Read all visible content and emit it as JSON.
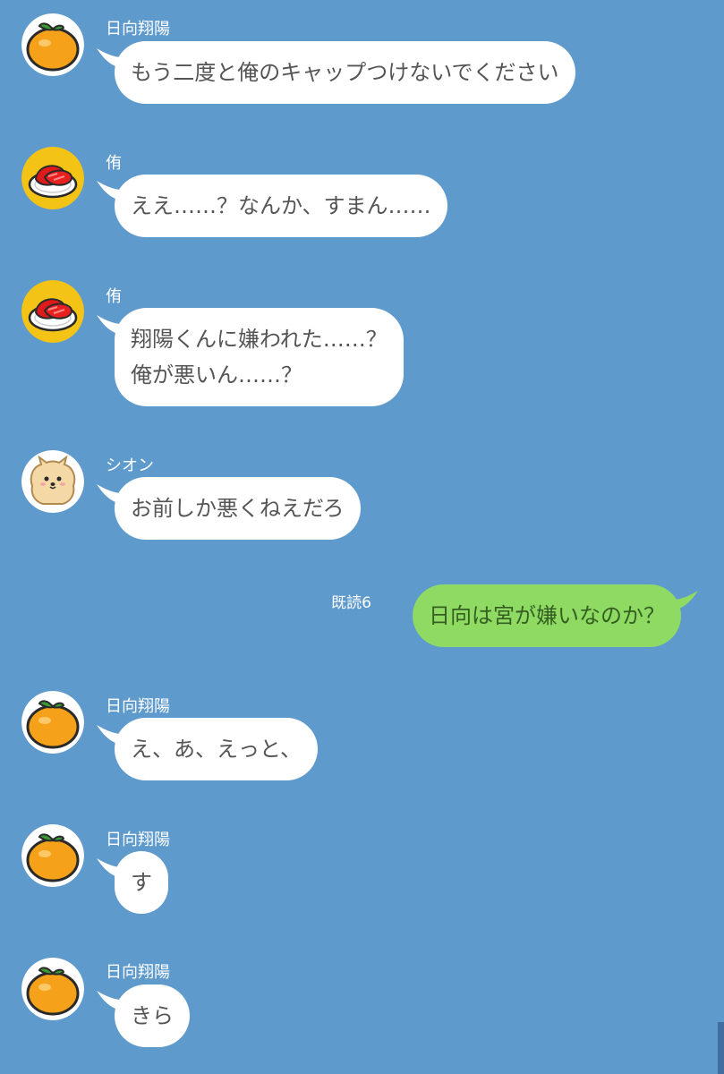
{
  "messages": [
    {
      "sender": "日向翔陽",
      "avatar": "orange-avatar",
      "lines": [
        "もう二度と俺のキャップつけないでください"
      ]
    },
    {
      "sender": "侑",
      "avatar": "sushi-avatar",
      "lines": [
        "ええ……？なんか、すまん……"
      ]
    },
    {
      "sender": "侑",
      "avatar": "sushi-avatar",
      "lines": [
        "翔陽くんに嫌われた……？",
        "俺が悪いん……？"
      ]
    },
    {
      "sender": "シオン",
      "avatar": "dog-avatar",
      "lines": [
        "お前しか悪くねえだろ"
      ]
    },
    {
      "outgoing": true,
      "read_receipt": "既読6",
      "lines": [
        "日向は宮が嫌いなのか？"
      ]
    },
    {
      "sender": "日向翔陽",
      "avatar": "orange-avatar",
      "lines": [
        "え、あ、えっと、"
      ]
    },
    {
      "sender": "日向翔陽",
      "avatar": "orange-avatar",
      "lines": [
        "す"
      ]
    },
    {
      "sender": "日向翔陽",
      "avatar": "orange-avatar",
      "lines": [
        "きら"
      ]
    }
  ],
  "colors": {
    "background": "#5f9acd",
    "incoming_bubble": "#ffffff",
    "outgoing_bubble": "#8fda62",
    "incoming_text": "#555555",
    "outgoing_text": "#355f22"
  }
}
